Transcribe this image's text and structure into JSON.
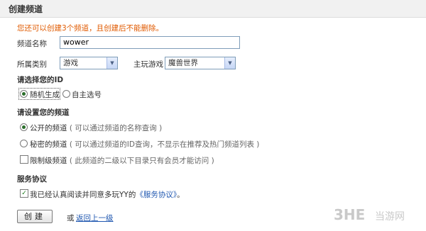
{
  "header": {
    "title": "创建频道"
  },
  "notice": "您还可以创建3个频道，且创建后不能删除。",
  "form": {
    "channel_name_label": "频道名称",
    "channel_name_value": "wower",
    "category_label": "所属类别",
    "category_value": "游戏",
    "main_game_label": "主玩游戏",
    "main_game_value": "魔兽世界"
  },
  "id_section": {
    "title": "请选择您的ID",
    "option_random": "随机生成",
    "option_custom": "自主选号"
  },
  "channel_section": {
    "title": "请设置您的频道",
    "public_label": "公开的频道",
    "public_hint": "( 可以通过频道的名称查询 )",
    "secret_label": "秘密的频道",
    "secret_hint": "( 可以通过频道的ID查询，不显示在推荐及热门频道列表 )",
    "restricted_label": "限制级频道",
    "restricted_hint": "( 此频道的二级以下目录只有会员才能访问 )"
  },
  "service_section": {
    "title": "服务协议",
    "agree_text": "我已经认真阅读并同意多玩YY的",
    "agree_link": "《服务协议》",
    "agree_end": "。"
  },
  "actions": {
    "create_label": "创建",
    "or_text": "或",
    "back_link": "返回上一级"
  },
  "watermark": {
    "logo": "3HE",
    "text": "当游网"
  }
}
